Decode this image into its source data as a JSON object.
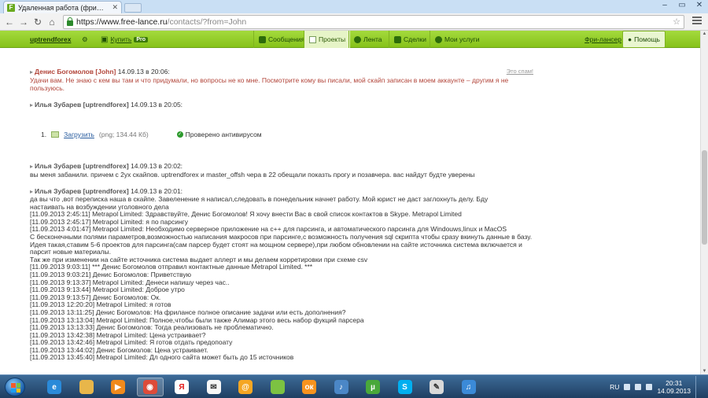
{
  "browser": {
    "tab_title": "Удаленная работа (фри…",
    "url_host": "https://www.free-lance.ru",
    "url_path": "/contacts/?from=John"
  },
  "site_menu": {
    "username": "uptrendforex",
    "buy_label": "Купить",
    "pro_badge": "Pro",
    "tabs": [
      {
        "label": "Сообщения"
      },
      {
        "label": "Проекты"
      },
      {
        "label": "Лента"
      },
      {
        "label": "Сделки"
      },
      {
        "label": "Мои услуги"
      }
    ],
    "freelancer_link": "Фри-лансер",
    "help_label": "Помощь"
  },
  "messages": [
    {
      "author": "Денис Богомолов [John]",
      "date": "14.09.13 в 20:06:",
      "spam_label": "Это спам!",
      "body": "Удачи вам. Не знаю с кем вы там и что придумали, но вопросы не ко мне. Посмотрите кому вы писали, мой скайп записан в моем аккаунте – другим я не пользуюсь."
    },
    {
      "author": "Илья Зубарев [uptrendforex]",
      "date": "14.09.13 в 20:05:",
      "attachment": {
        "index": "1.",
        "link": "Загрузить",
        "size": "(png; 134.44 Кб)",
        "status": "Проверено антивирусом"
      }
    },
    {
      "author": "Илья Зубарев [uptrendforex]",
      "date": "14.09.13 в 20:02:",
      "body": "вы меня забанили. причем с 2ух скайпов. uptrendforex и master_offsh чера в 22 обещали показть прогу и позавчера. вас найдут будте уверены"
    },
    {
      "author": "Илья Зубарев [uptrendforex]",
      "date": "14.09.13 в 20:01:",
      "lines": [
        "да вы что ,вот переписка наша в скайпе. Завеленение я написал,следовать в понедельник начнет работу. Мой юрист не даст заглохнуть делу. Бду",
        "настаивать на возбуждении уголовного дела",
        "[11.09.2013 2:45:11] Metrapol Limited: Здравствуйте, Денис Богомолов! Я хочу внести Вас в свой список контактов в Skype. Metrapol Limited",
        "[11.09.2013 2:45:17] Metrapol Limited: я по парсингу",
        "[11.09.2013 4:01:47] Metrapol Limited: Необходимо серверное приложение на с++ для парсинга, и автоматического парсинга для Windouws,linux и MacOS",
        "С бесконечными полями параметров,возможностью написания макросов при парсинге,с возможность получения sql скрипта чтобы сразу вкинуть данные в базу.",
        "Идея такая,ставим 5-6 проектов для парсинга(сам парсер будет стоят на мощном сервере),при любом обновлении на сайте источника система включается и",
        "парсит новые материалы.",
        "Так же при изменении на сайте источника система выдает аллерт и мы делаем корретировки при схеме csv",
        "[11.09.2013 9:03:11] *** Денис Богомолов отправил контактные данные Metrapol Limited. ***",
        "[11.09.2013 9:03:21] Денис Богомолов: Приветствую",
        "[11.09.2013 9:13:37] Metrapol Limited: Денеси напишу через час..",
        "[11.09.2013 9:13:44] Metrapol Limited: Доброе утро",
        "[11.09.2013 9:13:57] Денис Богомолов: Ок.",
        "[11.09.2013 12:20:20] Metrapol Limited: я готов",
        "[11.09.2013 13:11:25] Денис Богомолов: На фрилансе полное описание задачи или есть дополнения?",
        "[11.09.2013 13:13:04] Metrapol Limited: Полное,чтобы были также Алимар этого весь набор фукций парсера",
        "[11.09.2013 13:13:33] Денис Богомолов: Тогда реализовать не проблематично.",
        "[11.09.2013 13:42:38] Metrapol Limited: Цена устраивает?",
        "[11.09.2013 13:42:46] Metrapol Limited: Я готов отдать предопоату",
        "[11.09.2013 13:44:02] Денис Богомолов: Цена устраивает.",
        "[11.09.2013 13:45:40] Metrapol Limited: Дл одного сайта может быть до 15 источников"
      ]
    }
  ],
  "taskbar": {
    "apps": [
      {
        "icon": "ie-icon",
        "color": "#2a8ad9",
        "glyph": "e"
      },
      {
        "icon": "folder-icon",
        "color": "#e8b64a",
        "glyph": ""
      },
      {
        "icon": "media-player-icon",
        "color": "#f08a1c",
        "glyph": "▶"
      },
      {
        "icon": "chrome-icon",
        "color": "#dd4b39",
        "glyph": "◉"
      },
      {
        "icon": "yandex-icon",
        "color": "#ffffff",
        "glyph": "Я",
        "fg": "#e21a1a"
      },
      {
        "icon": "mail-icon",
        "color": "#f7f7f7",
        "glyph": "✉",
        "fg": "#333"
      },
      {
        "icon": "mail-agent-icon",
        "color": "#f5a623",
        "glyph": "@"
      },
      {
        "icon": "game-icon",
        "color": "#7cc242",
        "glyph": ""
      },
      {
        "icon": "odnoklassniki-icon",
        "color": "#f7931e",
        "glyph": "ок"
      },
      {
        "icon": "sound-icon",
        "color": "#4b87c7",
        "glyph": "♪"
      },
      {
        "icon": "utorrent-icon",
        "color": "#49a83a",
        "glyph": "µ"
      },
      {
        "icon": "skype-icon",
        "color": "#00aff0",
        "glyph": "S"
      },
      {
        "icon": "paint-icon",
        "color": "#d9d9d9",
        "glyph": "✎",
        "fg": "#333"
      },
      {
        "icon": "itunes-icon",
        "color": "#3b8ad8",
        "glyph": "♫"
      }
    ],
    "lang": "RU",
    "time": "20:31",
    "date": "14.09.2013"
  }
}
